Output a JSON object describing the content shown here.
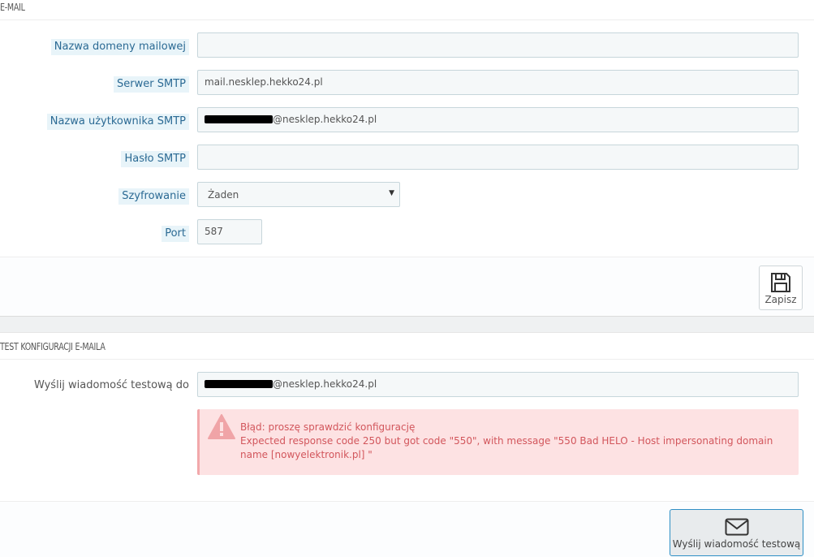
{
  "email_section": {
    "title": "E-MAIL",
    "fields": {
      "domain": {
        "label": "Nazwa domeny mailowej",
        "value": ""
      },
      "smtp_server": {
        "label": "Serwer SMTP",
        "value": "mail.nesklep.hekko24.pl"
      },
      "smtp_user": {
        "label": "Nazwa użytkownika SMTP",
        "value_suffix": "@nesklep.hekko24.pl"
      },
      "smtp_password": {
        "label": "Hasło SMTP",
        "value": ""
      },
      "encryption": {
        "label": "Szyfrowanie",
        "selected": "Żaden"
      },
      "port": {
        "label": "Port",
        "value": "587"
      }
    },
    "save_button": {
      "label": "Zapisz",
      "icon": "save-icon"
    }
  },
  "test_section": {
    "title": "TEST KONFIGURACJI E-MAILA",
    "send_to": {
      "label": "Wyślij wiadomość testową do",
      "value_suffix": "@nesklep.hekko24.pl"
    },
    "error": {
      "title": "Błąd: proszę sprawdzić konfigurację",
      "message": "Expected response code 250 but got code \"550\", with message \"550 Bad HELO - Host impersonating domain name [nowyelektronik.pl] \""
    },
    "send_button": {
      "label": "Wyślij wiadomość testową",
      "icon": "envelope-icon"
    }
  },
  "colors": {
    "label_text": "#2b6a94",
    "label_bg": "#e8f4f9",
    "error_text": "#d2565c",
    "error_bg": "#fde2e3",
    "accent_border": "#2e8fc5"
  }
}
